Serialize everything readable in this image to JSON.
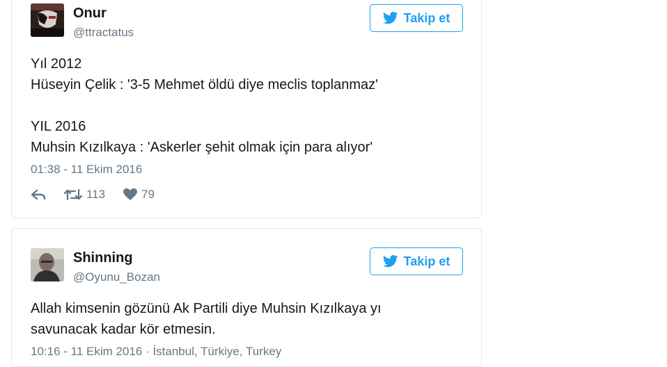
{
  "tweets": [
    {
      "author_name": "Onur",
      "author_handle": "@ttractatus",
      "follow_label": "Takip et",
      "text": "Yıl 2012\nHüseyin Çelik : '3-5 Mehmet öldü diye meclis toplanmaz'\n\nYIL 2016\nMuhsin Kızılkaya : 'Askerler şehit olmak için para alıyor'",
      "timestamp": "01:38 - 11 Ekim 2016",
      "retweets": "113",
      "likes": "79"
    },
    {
      "author_name": "Shinning",
      "author_handle": "@Oyunu_Bozan",
      "follow_label": "Takip et",
      "text": "Allah kimsenin gözünü Ak Partili diye Muhsin Kızılkaya yı\nsavunacak kadar kör etmesin.",
      "timestamp": "10:16 - 11 Ekim 2016 · İstanbul, Türkiye, Turkey"
    }
  ],
  "icons": {
    "follow": "twitter-bird-icon",
    "reply": "reply-icon",
    "retweet": "retweet-icon",
    "like": "heart-icon"
  },
  "colors": {
    "accent": "#1da1f2",
    "secondary_text": "#657786",
    "border": "#e1e8ed"
  }
}
